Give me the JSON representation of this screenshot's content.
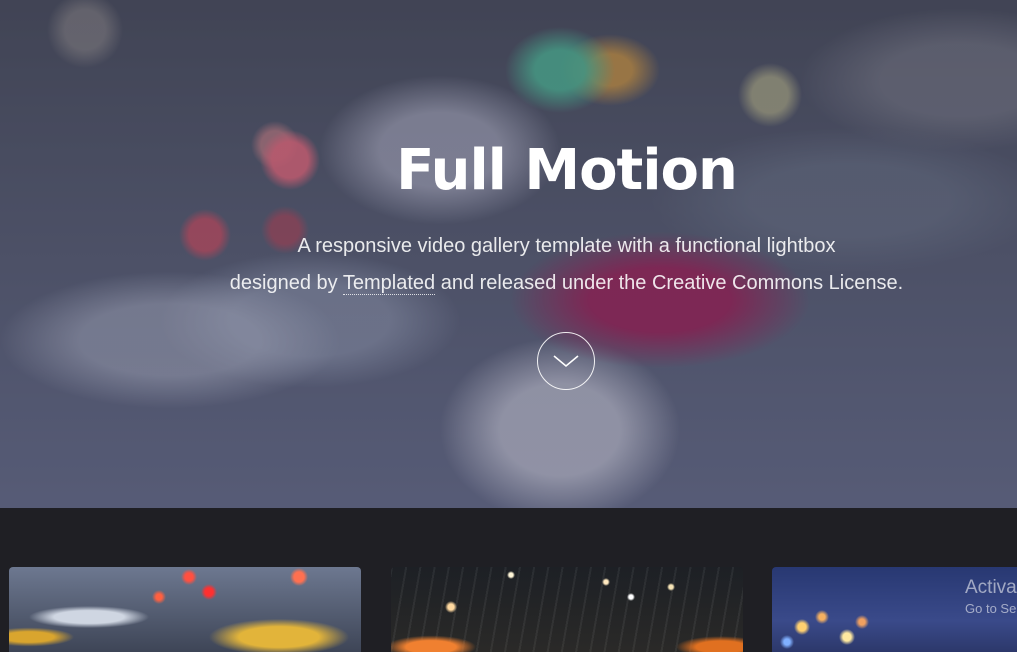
{
  "hero": {
    "title": "Full Motion",
    "subtitle_line1": "A responsive video gallery template with a functional lightbox",
    "subtitle_prefix": "designed by ",
    "subtitle_link": "Templated",
    "subtitle_suffix": " and released under the Creative Commons License.",
    "scroll_icon": "chevron-down-icon"
  },
  "gallery": {
    "items": [
      {
        "name": "traffic-thumbnail"
      },
      {
        "name": "city-night-thumbnail"
      },
      {
        "name": "city-lights-thumbnail"
      }
    ]
  },
  "watermark": {
    "title": "Activa",
    "subtitle": "Go to Se"
  }
}
